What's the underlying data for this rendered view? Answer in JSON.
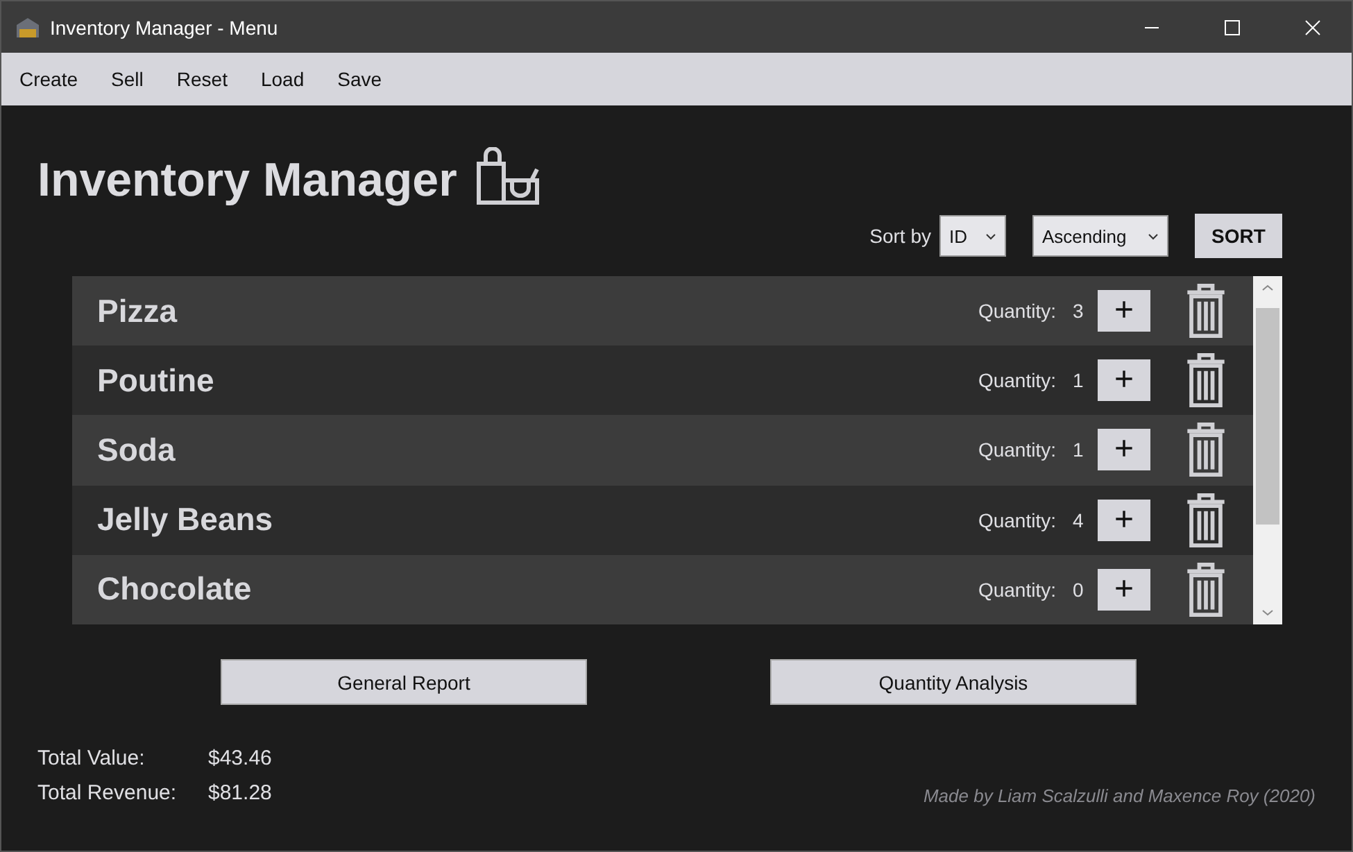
{
  "window": {
    "title": "Inventory Manager - Menu"
  },
  "menu": [
    "Create",
    "Sell",
    "Reset",
    "Load",
    "Save"
  ],
  "heading": "Inventory Manager",
  "sort": {
    "label": "Sort by",
    "field": "ID",
    "order": "Ascending",
    "button": "SORT"
  },
  "items": [
    {
      "name": "Pizza",
      "quantity_label": "Quantity:",
      "quantity": "3",
      "plus": "+"
    },
    {
      "name": "Poutine",
      "quantity_label": "Quantity:",
      "quantity": "1",
      "plus": "+"
    },
    {
      "name": "Soda",
      "quantity_label": "Quantity:",
      "quantity": "1",
      "plus": "+"
    },
    {
      "name": "Jelly Beans",
      "quantity_label": "Quantity:",
      "quantity": "4",
      "plus": "+"
    },
    {
      "name": "Chocolate",
      "quantity_label": "Quantity:",
      "quantity": "0",
      "plus": "+"
    }
  ],
  "buttons": [
    "General Report",
    "Quantity Analysis"
  ],
  "totals": [
    {
      "label": "Total Value:",
      "value": "$43.46"
    },
    {
      "label": "Total Revenue:",
      "value": "$81.28"
    }
  ],
  "credit": "Made by Liam Scalzulli and Maxence Roy (2020)"
}
